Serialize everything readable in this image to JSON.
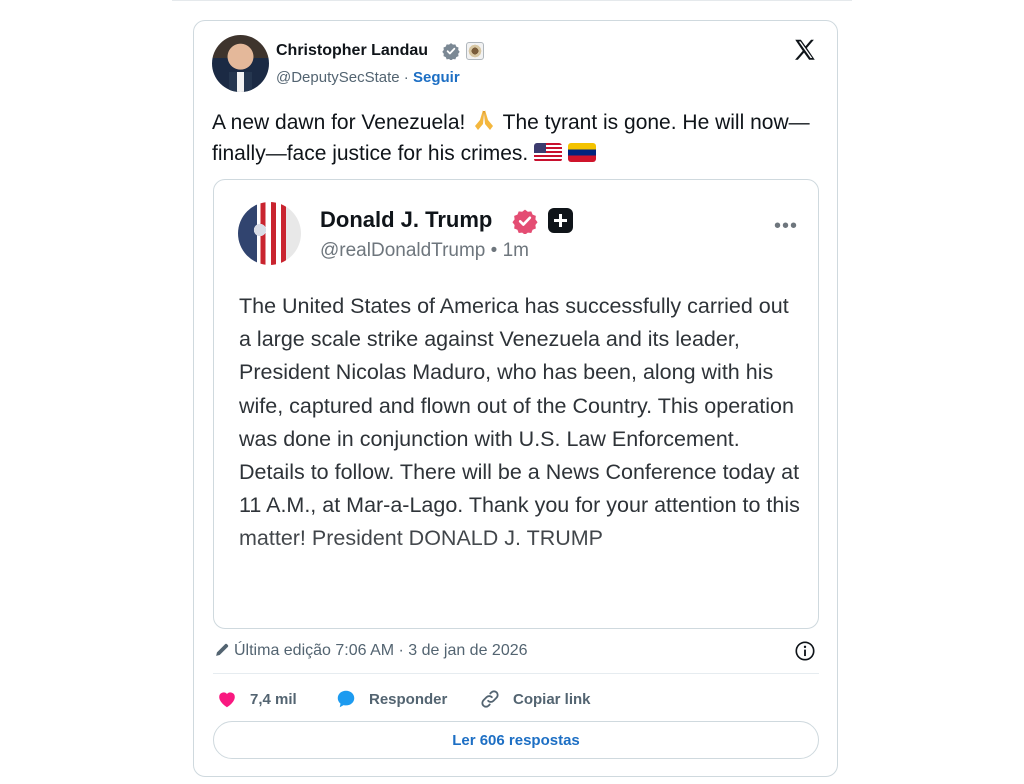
{
  "post": {
    "author_name": "Christopher Landau",
    "handle": "@DeputySecState",
    "separator": " · ",
    "follow_label": "Seguir",
    "text_part1": "A new dawn for Venezuela! ",
    "text_part2": " The tyrant is gone. He will now—finally—face justice for his crimes. ",
    "icons": [
      "verified-icon",
      "government-seal-icon",
      "x-logo-icon",
      "praying-hands-emoji",
      "us-flag-emoji",
      "venezuela-flag-emoji"
    ]
  },
  "quoted": {
    "name": "Donald J. Trump",
    "handle_time": "@realDonaldTrump • 1m",
    "more_label": "•••",
    "body": "The United States of America has successfully carried out a large scale strike against Venezuela and its leader, President Nicolas Maduro, who has been, along with his wife, captured and flown out of the Country. This operation was done in conjunction with U.S. Law Enforcement. Details to follow. There will be a News Conference today at 11 A.M., at Mar-a-Lago. Thank you for your attention to this matter! President DONALD J. TRUMP"
  },
  "meta": {
    "edited": "Última edição 7:06 AM · 3 de jan de 2026"
  },
  "actions": {
    "likes": "7,4 mil",
    "reply": "Responder",
    "copy_link": "Copiar link"
  },
  "replies_button": "Ler 606 respostas",
  "colors": {
    "verified_blue": "#1d9bf0",
    "like_pink": "#f91880",
    "link_blue": "#1d6fc4",
    "truth_badge": "#e44d73"
  }
}
